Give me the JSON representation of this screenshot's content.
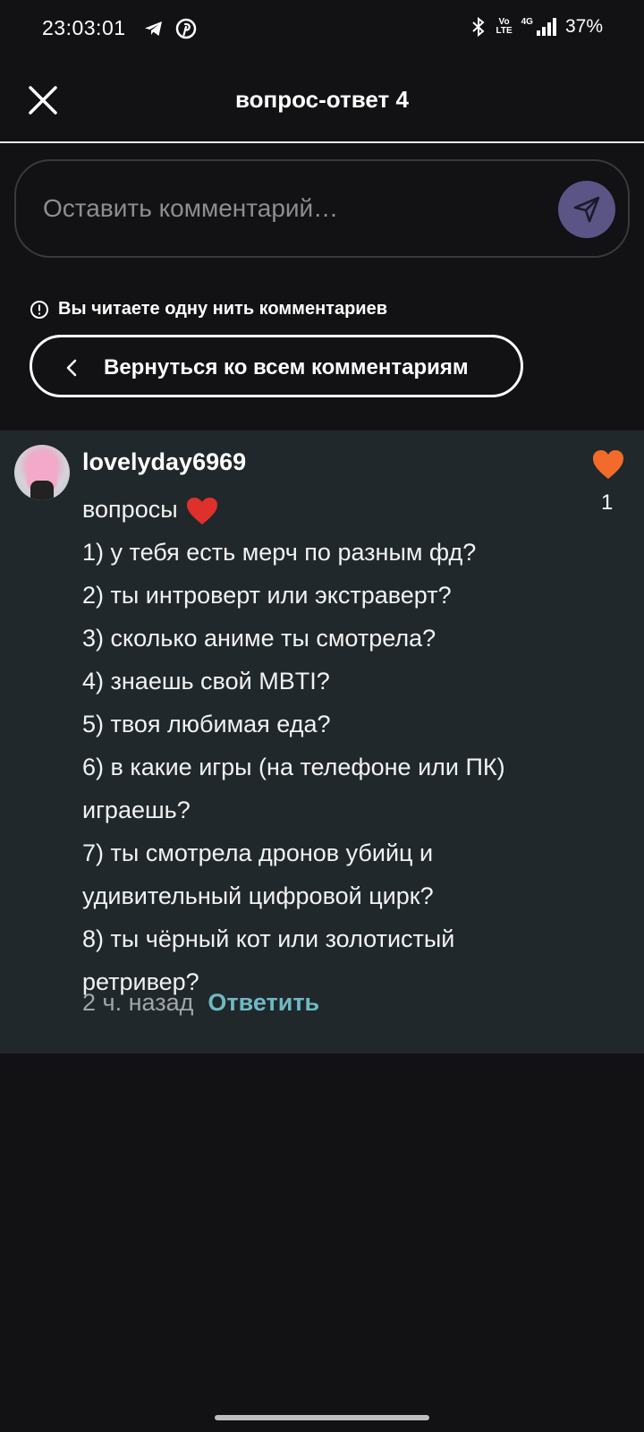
{
  "status_bar": {
    "time": "23:03:01",
    "volte": "Vo",
    "lte": "LTE",
    "network": "4G",
    "battery": "37%"
  },
  "header": {
    "title": "вопрос-ответ 4"
  },
  "comment_input": {
    "placeholder": "Оставить комментарий…"
  },
  "thread": {
    "notice": "Вы читаете одну нить комментариев",
    "back_label": "Вернуться ко всем комментариям"
  },
  "comment": {
    "username": "lovelyday6969",
    "likes": "1",
    "lines": [
      "вопросы",
      "1) у тебя есть мерч по разным фд?",
      "2) ты интроверт или экстраверт?",
      "3) сколько аниме ты смотрела?",
      "4) знаешь свой MBTI?",
      "5) твоя любимая еда?",
      "6) в какие игры (на телефоне или ПК)",
      "играешь?",
      "7) ты смотрела дронов убийц и",
      "удивительный цифровой цирк?",
      "8) ты чёрный кот или золотистый",
      "ретривер?"
    ],
    "time": "2 ч. назад",
    "reply_label": "Ответить"
  },
  "colors": {
    "background": "#121113",
    "card": "#20282b",
    "send_button": "#5a5585",
    "like_heart": "#f26b2a",
    "reply_link": "#6fb9c4"
  },
  "icons": {
    "close": "close-icon",
    "send": "send-icon",
    "info": "info-icon",
    "back": "chevron-left-icon",
    "like": "heart-icon"
  }
}
